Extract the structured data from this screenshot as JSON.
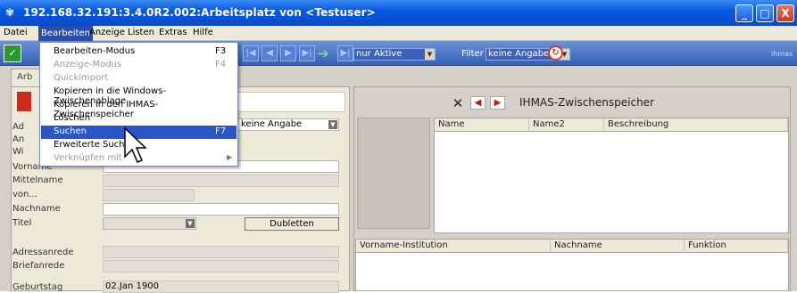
{
  "window": {
    "title": "192.168.32.191:3.4.0R2.002:Arbeitsplatz von <Testuser>",
    "buttons": {
      "min": "_",
      "max": "□",
      "close": "X"
    }
  },
  "menubar": [
    "Datei",
    "Bearbeiten",
    "Anzeige",
    "Listen",
    "Extras",
    "Hilfe"
  ],
  "toolbar": {
    "status_select": "nur Aktive",
    "filter_label": "Filter",
    "filter_value": "keine Angabe",
    "logo": "ihmas"
  },
  "tab": {
    "label": "Arb"
  },
  "dropdown_menu": [
    {
      "label": "Bearbeiten-Modus",
      "shortcut": "F3",
      "disabled": false
    },
    {
      "label": "Anzeige-Modus",
      "shortcut": "F4",
      "disabled": true
    },
    {
      "label": "Quickimport",
      "shortcut": "",
      "disabled": true
    },
    {
      "label": "Kopieren in die Windows-Zwischenablage",
      "shortcut": "",
      "disabled": false
    },
    {
      "label": "Kopieren in den IHMAS-Zwischenspeicher",
      "shortcut": "",
      "disabled": false
    },
    {
      "label": "Löschen",
      "shortcut": "",
      "disabled": false
    },
    {
      "label": "Suchen",
      "shortcut": "F7",
      "disabled": false,
      "highlighted": true
    },
    {
      "label": "Erweiterte Suche",
      "shortcut": "",
      "disabled": false
    },
    {
      "label": "Verknüpfen mit",
      "shortcut": "",
      "disabled": true,
      "submenu": true
    }
  ],
  "form": {
    "partial_labels": [
      "Ad",
      "An",
      "Wi"
    ],
    "keine_angabe": "keine Angabe",
    "vorname": "Vorname",
    "mittelname": "Mittelname",
    "von": "von...",
    "nachname": "Nachname",
    "titel": "Titel",
    "dubletten": "Dubletten",
    "adressanrede": "Adressanrede",
    "briefanrede": "Briefanrede",
    "geburtstag": "Geburtstag",
    "geburtstag_value": "02.Jan 1900"
  },
  "clipboard": {
    "title": "IHMAS-Zwischenspeicher",
    "columns": [
      "Name",
      "Name2",
      "Beschreibung"
    ]
  },
  "relations": {
    "columns": [
      "Vorname-Institution",
      "Nachname",
      "Funktion"
    ]
  },
  "colors": {
    "title_bar": "#0553d6",
    "menu_highlight": "#2c55c6",
    "toolbar": "#3560b5"
  }
}
